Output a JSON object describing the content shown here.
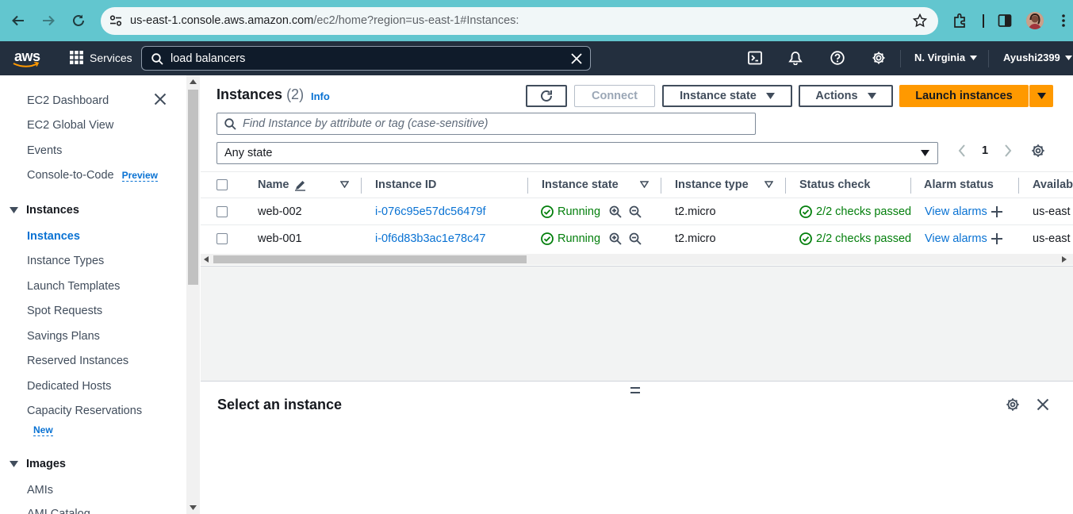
{
  "browser": {
    "url": "us-east-1.console.aws.amazon.com/ec2/home?region=us-east-1#Instances:",
    "url_host": "us-east-1.console.aws.amazon.com",
    "url_path": "/ec2/home?region=us-east-1#Instances:"
  },
  "topnav": {
    "logo": "aws",
    "services_label": "Services",
    "search_value": "load balancers",
    "region": "N. Virginia",
    "user": "Ayushi2399"
  },
  "sidebar": {
    "items": [
      {
        "label": "EC2 Dashboard"
      },
      {
        "label": "EC2 Global View"
      },
      {
        "label": "Events"
      },
      {
        "label": "Console-to-Code",
        "badge": "Preview"
      }
    ],
    "instances_section": {
      "title": "Instances",
      "items": [
        {
          "label": "Instances",
          "active": true
        },
        {
          "label": "Instance Types"
        },
        {
          "label": "Launch Templates"
        },
        {
          "label": "Spot Requests"
        },
        {
          "label": "Savings Plans"
        },
        {
          "label": "Reserved Instances"
        },
        {
          "label": "Dedicated Hosts"
        },
        {
          "label": "Capacity Reservations",
          "badge": "New"
        }
      ]
    },
    "images_section": {
      "title": "Images",
      "items": [
        {
          "label": "AMIs"
        },
        {
          "label": "AMI Catalog"
        }
      ]
    }
  },
  "instances_panel": {
    "title": "Instances",
    "count": "(2)",
    "info": "Info",
    "connect_label": "Connect",
    "instance_state_label": "Instance state",
    "actions_label": "Actions",
    "launch_label": "Launch instances",
    "filter_placeholder": "Find Instance by attribute or tag (case-sensitive)",
    "state_filter": "Any state",
    "page": "1",
    "columns": [
      "Name",
      "Instance ID",
      "Instance state",
      "Instance type",
      "Status check",
      "Alarm status",
      "Availab"
    ],
    "rows": [
      {
        "name": "web-002",
        "id": "i-076c95e57dc56479f",
        "state": "Running",
        "type": "t2.micro",
        "status": "2/2 checks passed",
        "alarm": "View alarms",
        "az": "us-east"
      },
      {
        "name": "web-001",
        "id": "i-0f6d83b3ac1e78c47",
        "state": "Running",
        "type": "t2.micro",
        "status": "2/2 checks passed",
        "alarm": "View alarms",
        "az": "us-east"
      }
    ],
    "horizontal_scroll_fraction": 0.37
  },
  "details_panel": {
    "title": "Select an instance"
  },
  "colors": {
    "browser_bar": "#62c6cf",
    "aws_nav": "#232f3e",
    "launch_orange": "#ff9900",
    "link_blue": "#0972d3",
    "success_green": "#037f0c"
  }
}
